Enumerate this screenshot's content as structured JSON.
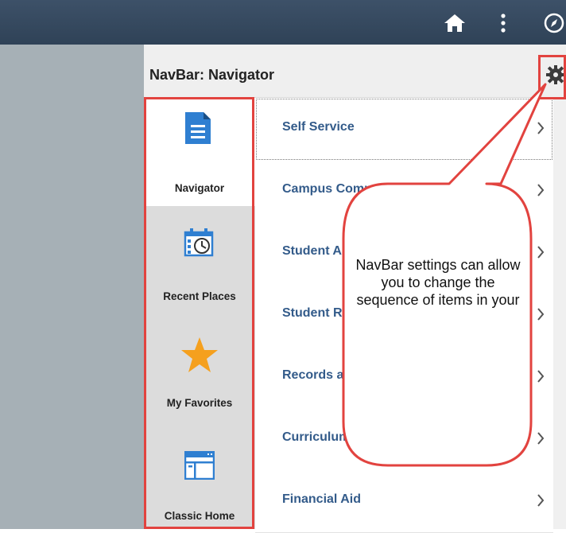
{
  "panel": {
    "title": "NavBar: Navigator"
  },
  "sidebar": {
    "items": [
      {
        "label": "Navigator",
        "icon": "document-icon",
        "active": true
      },
      {
        "label": "Recent Places",
        "icon": "calendar-clock-icon"
      },
      {
        "label": "My Favorites",
        "icon": "star-icon"
      },
      {
        "label": "Classic Home",
        "icon": "window-icon"
      }
    ]
  },
  "nav_list": {
    "items": [
      {
        "label": "Self Service"
      },
      {
        "label": "Campus Community"
      },
      {
        "label": "Student Admissions"
      },
      {
        "label": "Student Records"
      },
      {
        "label": "Records and Enrollment"
      },
      {
        "label": "Curriculum Management"
      },
      {
        "label": "Financial Aid"
      }
    ]
  },
  "callout": {
    "text": "NavBar settings can allow you to change the sequence of items in your"
  },
  "colors": {
    "topbar": "#34485e",
    "highlight_border": "#e2433f",
    "link_blue": "#335b8a",
    "icon_blue": "#2f7fd1",
    "star_orange": "#f5a01e"
  }
}
